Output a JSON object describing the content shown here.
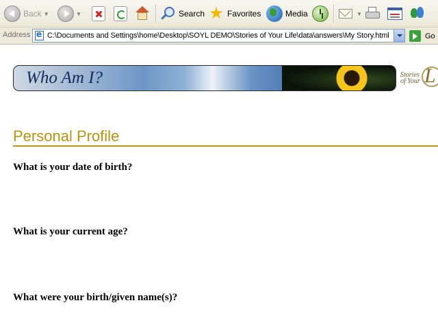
{
  "toolbar": {
    "back_label": "Back",
    "search_label": "Search",
    "favorites_label": "Favorites",
    "media_label": "Media"
  },
  "address": {
    "label": "Address",
    "url": "C:\\Documents and Settings\\home\\Desktop\\SOYL DEMO\\Stories of Your Life\\data\\answers\\My Story.html",
    "go_label": "Go"
  },
  "page": {
    "banner_title": "Who Am I?",
    "logo_text_line1": "Stories",
    "logo_text_line2": "of Your",
    "logo_text_word": "Life",
    "heading": "Personal Profile",
    "questions": [
      "What is your date of birth?",
      "What is your current age?",
      "What were your birth/given name(s)?"
    ]
  },
  "colors": {
    "heading": "#b8940f",
    "banner_text": "#132b5a"
  }
}
